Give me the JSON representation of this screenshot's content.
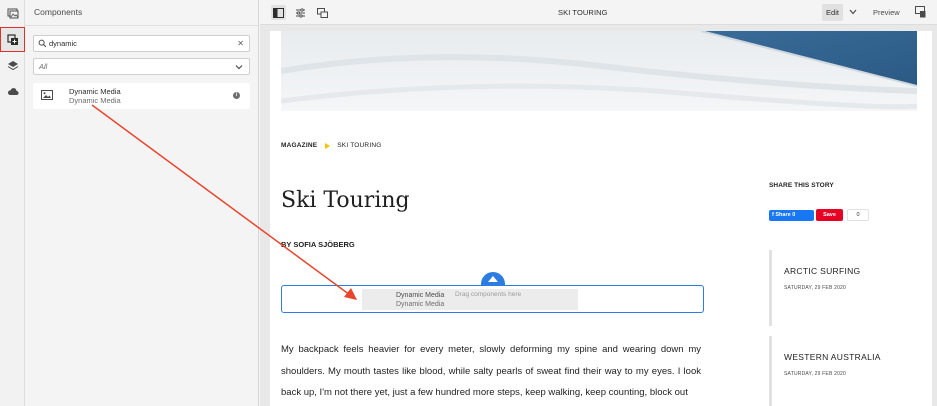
{
  "panel": {
    "title": "Components",
    "search_value": "dynamic",
    "filter_value": "All",
    "result": {
      "name": "Dynamic Media",
      "group": "Dynamic Media"
    }
  },
  "toolbar": {
    "page_title": "SKI TOURING",
    "edit_label": "Edit",
    "preview_label": "Preview"
  },
  "page": {
    "breadcrumb": [
      "MAGAZINE",
      "SKI TOURING"
    ],
    "title": "Ski Touring",
    "byline": "BY SOFIA SJÖBERG",
    "dropzone": {
      "hint": "Drag components here",
      "ghost_name": "Dynamic Media",
      "ghost_sub": "Dynamic Media"
    },
    "body": "My backpack feels heavier for every meter, slowly deforming my spine and wearing down my shoulders. My mouth tastes like blood, while salty pearls of sweat find their way to my eyes. I look back up, I'm not there yet, just a few hundred more steps, keep walking, keep counting, block out",
    "share": {
      "title": "SHARE THIS STORY",
      "facebook_label": "Share 0",
      "pinterest_label": "Save",
      "pinterest_count": "0"
    },
    "related": [
      {
        "title": "ARCTIC SURFING",
        "date": "SATURDAY, 29 FEB 2020"
      },
      {
        "title": "WESTERN AUSTRALIA",
        "date": "SATURDAY, 29 FEB 2020"
      }
    ]
  },
  "colors": {
    "accent_blue": "#2d7de1",
    "highlight_red": "#e0322b",
    "breadcrumb_arrow": "#f5c400",
    "facebook": "#1877f2",
    "pinterest": "#e60023"
  },
  "icons": [
    "assets-icon",
    "components-icon",
    "layers-icon",
    "cloud-icon",
    "side-panel-icon",
    "page-properties-icon",
    "annotations-icon",
    "emulator-icon",
    "search-icon",
    "info-icon",
    "image-icon"
  ]
}
